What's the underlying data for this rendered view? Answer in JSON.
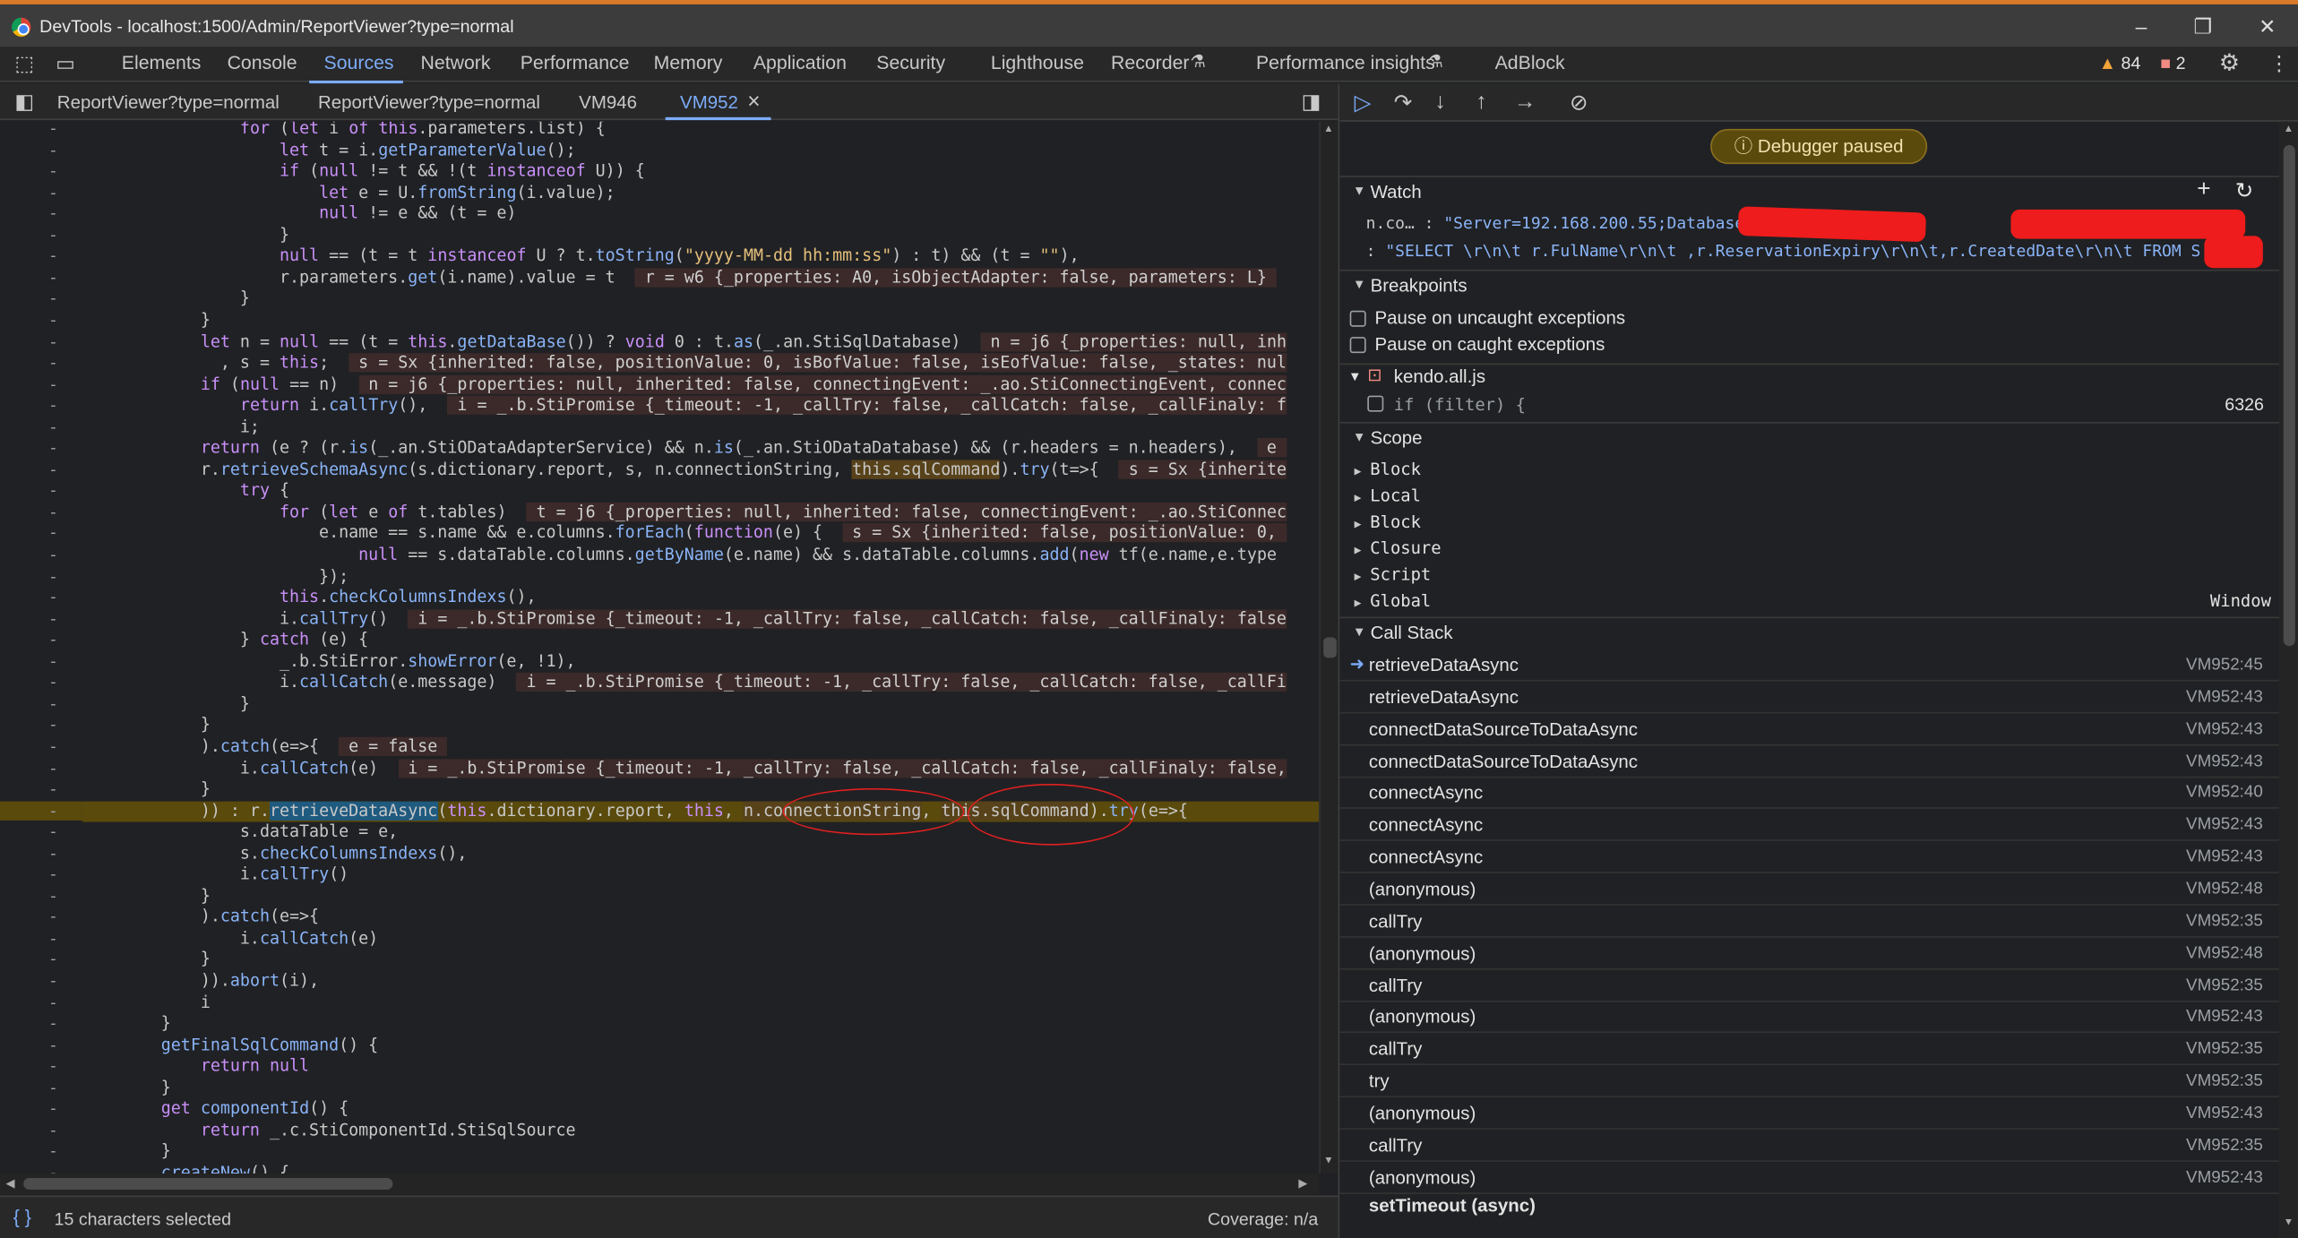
{
  "window": {
    "title": "DevTools - localhost:1500/Admin/ReportViewer?type=normal",
    "minimize": "–",
    "restore": "❐",
    "close": "✕"
  },
  "maintabs": {
    "items": [
      "Elements",
      "Console",
      "Sources",
      "Network",
      "Performance",
      "Memory",
      "Application",
      "Security",
      "Lighthouse",
      "Recorder",
      "Performance insights",
      "AdBlock"
    ],
    "active": "Sources",
    "warnings": "84",
    "errors": "2"
  },
  "filetabs": [
    "ReportViewer?type=normal",
    "ReportViewer?type=normal",
    "VM946",
    "VM952"
  ],
  "filetab_close": "×",
  "editor": {
    "gutter_mark": "-",
    "lines": [
      [
        [
          "                ",
          ""
        ],
        [
          "for",
          "kw"
        ],
        [
          " (",
          "id"
        ],
        [
          "let",
          "kw"
        ],
        [
          " i ",
          "id"
        ],
        [
          "of",
          "kw"
        ],
        [
          " ",
          "id"
        ],
        [
          "this",
          "kw"
        ],
        [
          ".parameters.list) {",
          "id"
        ]
      ],
      [
        [
          "                    ",
          ""
        ],
        [
          "let",
          "kw"
        ],
        [
          " t = i.",
          "id"
        ],
        [
          "getParameterValue",
          "fn"
        ],
        [
          "();",
          "id"
        ]
      ],
      [
        [
          "                    ",
          ""
        ],
        [
          "if",
          "kw"
        ],
        [
          " (",
          "id"
        ],
        [
          "null",
          "kw"
        ],
        [
          " != t && !(t ",
          "id"
        ],
        [
          "instanceof",
          "kw"
        ],
        [
          " U)) {",
          "id"
        ]
      ],
      [
        [
          "                        ",
          ""
        ],
        [
          "let",
          "kw"
        ],
        [
          " e = U.",
          "id"
        ],
        [
          "fromString",
          "fn"
        ],
        [
          "(i.value);",
          "id"
        ]
      ],
      [
        [
          "                        ",
          ""
        ],
        [
          "null",
          "kw"
        ],
        [
          " != e && (t = e)",
          "id"
        ]
      ],
      [
        [
          "                    }",
          ""
        ]
      ],
      [
        [
          "                    ",
          ""
        ],
        [
          "null",
          "kw"
        ],
        [
          " == (t = t ",
          "id"
        ],
        [
          "instanceof",
          "kw"
        ],
        [
          " U ? t.",
          "id"
        ],
        [
          "toString",
          "fn"
        ],
        [
          "(",
          "id"
        ],
        [
          "\"yyyy-MM-dd hh:mm:ss\"",
          "str"
        ],
        [
          ") : t) && (t = ",
          "id"
        ],
        [
          "\"\"",
          "str"
        ],
        [
          "),",
          "id"
        ]
      ],
      [
        [
          "                    r.parameters.",
          "id"
        ],
        [
          "get",
          "fn"
        ],
        [
          "(i.name).value = t  ",
          "id"
        ],
        [
          " r = w6 {_properties: A0, isObjectAdapter: false, parameters: L} ",
          "inline"
        ]
      ],
      [
        [
          "                }",
          ""
        ]
      ],
      [
        [
          "            }",
          ""
        ]
      ],
      [
        [
          "            ",
          ""
        ],
        [
          "let",
          "kw"
        ],
        [
          " n = ",
          "id"
        ],
        [
          "null",
          "kw"
        ],
        [
          " == (t = ",
          "id"
        ],
        [
          "this",
          "kw"
        ],
        [
          ".",
          "id"
        ],
        [
          "getDataBase",
          "fn"
        ],
        [
          "()) ? ",
          "id"
        ],
        [
          "void",
          "kw"
        ],
        [
          " 0 : t.",
          "id"
        ],
        [
          "as",
          "fn"
        ],
        [
          "(_.an.StiSqlDatabase)  ",
          "id"
        ],
        [
          " n = j6 {_properties: null, inh",
          "inline"
        ]
      ],
      [
        [
          "              , s = ",
          "id"
        ],
        [
          "this",
          "kw"
        ],
        [
          ";  ",
          "id"
        ],
        [
          " s = Sx {inherited: false, positionValue: 0, isBofValue: false, isEofValue: false, _states: nul",
          "inline"
        ]
      ],
      [
        [
          "            ",
          ""
        ],
        [
          "if",
          "kw"
        ],
        [
          " (",
          "id"
        ],
        [
          "null",
          "kw"
        ],
        [
          " == n)  ",
          "id"
        ],
        [
          " n = j6 {_properties: null, inherited: false, connectingEvent: _.ao.StiConnectingEvent, connec",
          "inline"
        ]
      ],
      [
        [
          "                ",
          ""
        ],
        [
          "return",
          "kw"
        ],
        [
          " i.",
          "id"
        ],
        [
          "callTry",
          "fn"
        ],
        [
          "(),  ",
          "id"
        ],
        [
          " i = _.b.StiPromise {_timeout: -1, _callTry: false, _callCatch: false, _callFinaly: f",
          "inline"
        ]
      ],
      [
        [
          "                i;",
          ""
        ]
      ],
      [
        [
          "            ",
          ""
        ],
        [
          "return",
          "kw"
        ],
        [
          " (e ? (r.",
          "id"
        ],
        [
          "is",
          "fn"
        ],
        [
          "(_.an.StiODataAdapterService) && n.",
          "id"
        ],
        [
          "is",
          "fn"
        ],
        [
          "(_.an.StiODataDatabase) && (r.headers = n.headers),  ",
          "id"
        ],
        [
          " e ",
          "inline"
        ]
      ],
      [
        [
          "            r.",
          "id"
        ],
        [
          "retrieveSchemaAsync",
          "fn"
        ],
        [
          "(s.dictionary.report, s, n.connectionString, ",
          "id"
        ],
        [
          "this.sqlCommand",
          "hl"
        ],
        [
          ").",
          "id"
        ],
        [
          "try",
          "fn"
        ],
        [
          "(t=>{  ",
          "id"
        ],
        [
          " s = Sx {inherite",
          "inline"
        ]
      ],
      [
        [
          "                ",
          ""
        ],
        [
          "try",
          "kw"
        ],
        [
          " {",
          "id"
        ]
      ],
      [
        [
          "                    ",
          ""
        ],
        [
          "for",
          "kw"
        ],
        [
          " (",
          "id"
        ],
        [
          "let",
          "kw"
        ],
        [
          " e ",
          "id"
        ],
        [
          "of",
          "kw"
        ],
        [
          " t.tables)  ",
          "id"
        ],
        [
          " t = j6 {_properties: null, inherited: false, connectingEvent: _.ao.StiConnec",
          "inline"
        ]
      ],
      [
        [
          "                        e.name == s.name && e.columns.",
          "id"
        ],
        [
          "forEach",
          "fn"
        ],
        [
          "(",
          "id"
        ],
        [
          "function",
          "kw"
        ],
        [
          "(e) {  ",
          "id"
        ],
        [
          " s = Sx {inherited: false, positionValue: 0, ",
          "inline"
        ]
      ],
      [
        [
          "                            ",
          ""
        ],
        [
          "null",
          "kw"
        ],
        [
          " == s.dataTable.columns.",
          "id"
        ],
        [
          "getByName",
          "fn"
        ],
        [
          "(e.name) && s.dataTable.columns.",
          "id"
        ],
        [
          "add",
          "fn"
        ],
        [
          "(",
          "id"
        ],
        [
          "new",
          "kw"
        ],
        [
          " tf(e.name,e.type",
          "id"
        ]
      ],
      [
        [
          "                        });",
          ""
        ]
      ],
      [
        [
          "                    ",
          ""
        ],
        [
          "this",
          "kw"
        ],
        [
          ".",
          "id"
        ],
        [
          "checkColumnsIndexs",
          "fn"
        ],
        [
          "(),",
          "id"
        ]
      ],
      [
        [
          "                    i.",
          "id"
        ],
        [
          "callTry",
          "fn"
        ],
        [
          "()  ",
          "id"
        ],
        [
          " i = _.b.StiPromise {_timeout: -1, _callTry: false, _callCatch: false, _callFinaly: false",
          "inline"
        ]
      ],
      [
        [
          "                } ",
          ""
        ],
        [
          "catch",
          "kw"
        ],
        [
          " (e) {",
          "id"
        ]
      ],
      [
        [
          "                    _.b.StiError.",
          "id"
        ],
        [
          "showError",
          "fn"
        ],
        [
          "(e, !1),",
          "id"
        ]
      ],
      [
        [
          "                    i.",
          "id"
        ],
        [
          "callCatch",
          "fn"
        ],
        [
          "(e.message)  ",
          "id"
        ],
        [
          " i = _.b.StiPromise {_timeout: -1, _callTry: false, _callCatch: false, _callFi",
          "inline"
        ]
      ],
      [
        [
          "                }",
          ""
        ]
      ],
      [
        [
          "            }",
          ""
        ]
      ],
      [
        [
          "            ).",
          "id"
        ],
        [
          "catch",
          "fn"
        ],
        [
          "(e=>{  ",
          "id"
        ],
        [
          " e = false ",
          "inline"
        ]
      ],
      [
        [
          "                i.",
          "id"
        ],
        [
          "callCatch",
          "fn"
        ],
        [
          "(e)  ",
          "id"
        ],
        [
          " i = _.b.StiPromise {_timeout: -1, _callTry: false, _callCatch: false, _callFinaly: false,",
          "inline"
        ]
      ],
      [
        [
          "            }",
          ""
        ]
      ],
      [
        [
          "            )) : r.",
          "id"
        ],
        [
          "retrieveDataAsync",
          "sel"
        ],
        [
          "(",
          "id"
        ],
        [
          "this",
          "kw"
        ],
        [
          ".dictionary.report, ",
          "id"
        ],
        [
          "this",
          "kw"
        ],
        [
          ", ",
          "id"
        ],
        [
          "n.connectionString",
          "hl"
        ],
        [
          ", ",
          "id"
        ],
        [
          "this.sqlCommand",
          "hl"
        ],
        [
          ").",
          "id"
        ],
        [
          "try",
          "fn"
        ],
        [
          "(e=>{",
          "id"
        ]
      ],
      [
        [
          "                s.dataTable = e,",
          ""
        ]
      ],
      [
        [
          "                s.",
          "id"
        ],
        [
          "checkColumnsIndexs",
          "fn"
        ],
        [
          "(),",
          "id"
        ]
      ],
      [
        [
          "                i.",
          "id"
        ],
        [
          "callTry",
          "fn"
        ],
        [
          "()",
          "id"
        ]
      ],
      [
        [
          "            }",
          ""
        ]
      ],
      [
        [
          "            ).",
          "id"
        ],
        [
          "catch",
          "fn"
        ],
        [
          "(e=>{",
          "id"
        ]
      ],
      [
        [
          "                i.",
          "id"
        ],
        [
          "callCatch",
          "fn"
        ],
        [
          "(e)",
          "id"
        ]
      ],
      [
        [
          "            }",
          ""
        ]
      ],
      [
        [
          "            )).",
          "id"
        ],
        [
          "abort",
          "fn"
        ],
        [
          "(i),",
          "id"
        ]
      ],
      [
        [
          "            i",
          ""
        ]
      ],
      [
        [
          "        }",
          ""
        ]
      ],
      [
        [
          "        ",
          ""
        ],
        [
          "getFinalSqlCommand",
          "fn"
        ],
        [
          "() {",
          "id"
        ]
      ],
      [
        [
          "            ",
          ""
        ],
        [
          "return",
          "kw"
        ],
        [
          " ",
          "id"
        ],
        [
          "null",
          "kw"
        ]
      ],
      [
        [
          "        }",
          ""
        ]
      ],
      [
        [
          "        ",
          ""
        ],
        [
          "get",
          "kw"
        ],
        [
          " ",
          "id"
        ],
        [
          "componentId",
          "fn"
        ],
        [
          "() {",
          "id"
        ]
      ],
      [
        [
          "            ",
          ""
        ],
        [
          "return",
          "kw"
        ],
        [
          " _.c.StiComponentId.StiSqlSource",
          "id"
        ]
      ],
      [
        [
          "        }",
          ""
        ]
      ],
      [
        [
          "        ",
          ""
        ],
        [
          "createNew",
          "fn"
        ],
        [
          "() {",
          "id"
        ]
      ]
    ]
  },
  "statusbar": {
    "braces": "{ }",
    "selection": "15 characters selected",
    "coverage": "Coverage: n/a"
  },
  "debugger": {
    "paused_label": "Debugger paused",
    "watch": {
      "label": "Watch",
      "line1_key": "n.co… : ",
      "line1_value": "\"Server=192.168.200.55;Database=                    ;user id=                         @…",
      "line2_key": ": ",
      "line2_value": "\"SELECT \\r\\n\\t r.FulName\\r\\n\\t ,r.ReservationExpiry\\r\\n\\t,r.CreatedDate\\r\\n\\t FROM S      x…"
    },
    "breakpoints": {
      "label": "Breakpoints",
      "uncaught": "Pause on uncaught exceptions",
      "caught": "Pause on caught exceptions",
      "file": "kendo.all.js",
      "bp_code": "if (filter) {",
      "bp_line": "6326"
    },
    "scope": {
      "label": "Scope",
      "items": [
        "Block",
        "Local",
        "Block",
        "Closure",
        "Script",
        "Global"
      ],
      "global_value": "Window"
    },
    "callstack": {
      "label": "Call Stack",
      "frames": [
        {
          "name": "retrieveDataAsync",
          "loc": "VM952:45"
        },
        {
          "name": "retrieveDataAsync",
          "loc": "VM952:43"
        },
        {
          "name": "connectDataSourceToDataAsync",
          "loc": "VM952:43"
        },
        {
          "name": "connectDataSourceToDataAsync",
          "loc": "VM952:43"
        },
        {
          "name": "connectAsync",
          "loc": "VM952:40"
        },
        {
          "name": "connectAsync",
          "loc": "VM952:43"
        },
        {
          "name": "connectAsync",
          "loc": "VM952:43"
        },
        {
          "name": "(anonymous)",
          "loc": "VM952:48"
        },
        {
          "name": "callTry",
          "loc": "VM952:35"
        },
        {
          "name": "(anonymous)",
          "loc": "VM952:48"
        },
        {
          "name": "callTry",
          "loc": "VM952:35"
        },
        {
          "name": "(anonymous)",
          "loc": "VM952:43"
        },
        {
          "name": "callTry",
          "loc": "VM952:35"
        },
        {
          "name": "try",
          "loc": "VM952:35"
        },
        {
          "name": "(anonymous)",
          "loc": "VM952:43"
        },
        {
          "name": "callTry",
          "loc": "VM952:35"
        },
        {
          "name": "(anonymous)",
          "loc": "VM952:43"
        }
      ],
      "async_label": "setTimeout (async)"
    }
  }
}
